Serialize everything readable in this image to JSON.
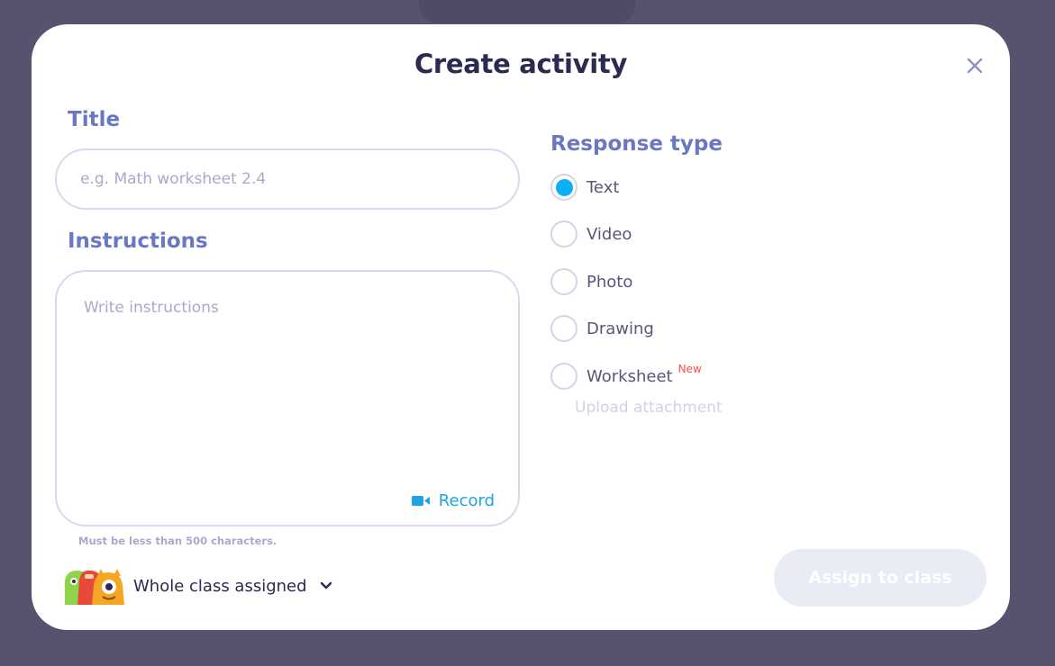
{
  "modal": {
    "title": "Create activity"
  },
  "form": {
    "title_label": "Title",
    "title_placeholder": "e.g. Math worksheet 2.4",
    "title_value": "",
    "instructions_label": "Instructions",
    "instructions_placeholder": "Write instructions",
    "record_label": "Record",
    "helper_text": "Must be less than 500 characters.",
    "assign_to_label": "Whole class assigned"
  },
  "response_type": {
    "label": "Response type",
    "selected": "Text",
    "options": [
      {
        "label": "Text",
        "checked": true
      },
      {
        "label": "Video",
        "checked": false
      },
      {
        "label": "Photo",
        "checked": false
      },
      {
        "label": "Drawing",
        "checked": false
      },
      {
        "label": "Worksheet",
        "checked": false,
        "badge": "New"
      }
    ],
    "upload_label": "Upload attachment"
  },
  "actions": {
    "assign_label": "Assign to class"
  },
  "colors": {
    "backdrop": "#57536f",
    "title": "#2c2a50",
    "section_label": "#6a78c4",
    "accent_blue": "#0ab0f3",
    "record_blue": "#1fa3e3",
    "placeholder": "#a8a9cc",
    "badge_red": "#ff4b4b",
    "disabled_button": "#e9ebf5"
  }
}
